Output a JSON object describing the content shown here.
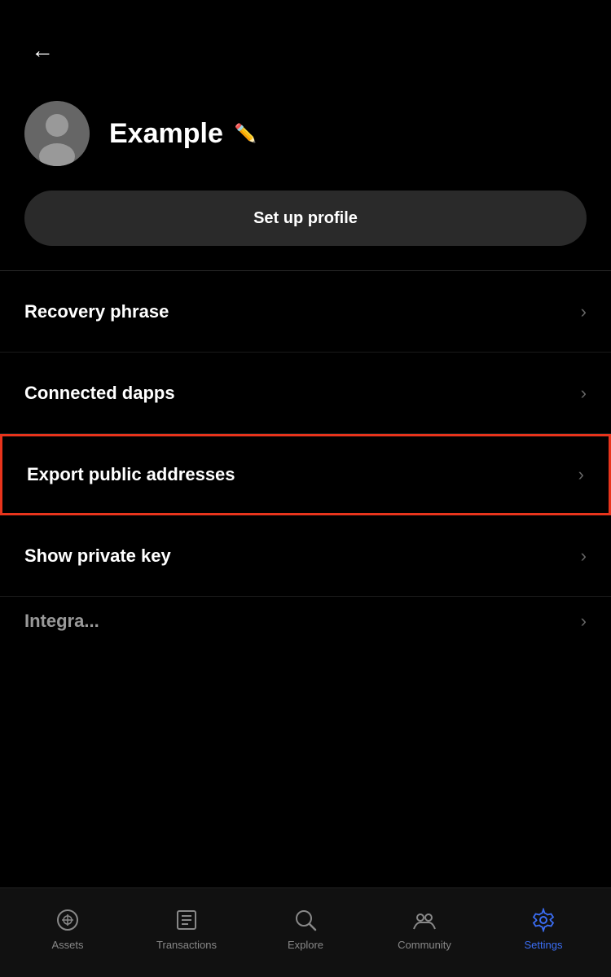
{
  "header": {
    "back_label": "←"
  },
  "profile": {
    "name": "Example",
    "setup_button_label": "Set up profile"
  },
  "menu_items": [
    {
      "id": "recovery-phrase",
      "label": "Recovery phrase",
      "highlighted": false
    },
    {
      "id": "connected-dapps",
      "label": "Connected dapps",
      "highlighted": false
    },
    {
      "id": "export-public-addresses",
      "label": "Export public addresses",
      "highlighted": true
    },
    {
      "id": "show-private-key",
      "label": "Show private key",
      "highlighted": false
    }
  ],
  "partial_item": {
    "label": "Integra..."
  },
  "bottom_nav": {
    "items": [
      {
        "id": "assets",
        "label": "Assets",
        "active": false
      },
      {
        "id": "transactions",
        "label": "Transactions",
        "active": false
      },
      {
        "id": "explore",
        "label": "Explore",
        "active": false
      },
      {
        "id": "community",
        "label": "Community",
        "active": false
      },
      {
        "id": "settings",
        "label": "Settings",
        "active": true
      }
    ]
  }
}
